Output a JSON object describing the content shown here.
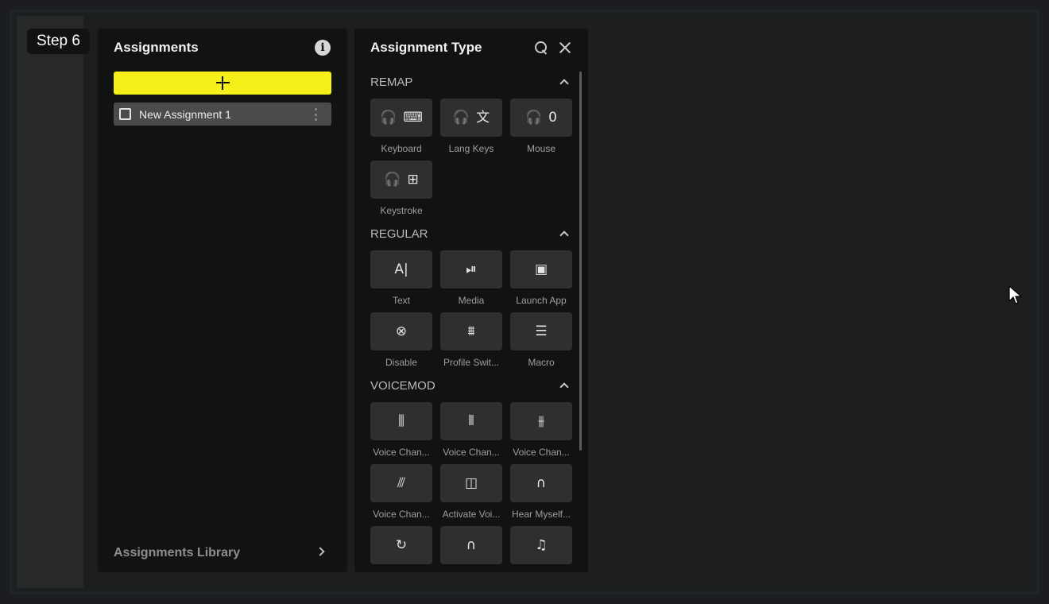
{
  "step_badge": "Step 6",
  "assignments": {
    "title": "Assignments",
    "items": [
      {
        "label": "New Assignment 1"
      }
    ],
    "library_label": "Assignments Library"
  },
  "assignment_type": {
    "title": "Assignment Type",
    "sections": [
      {
        "title": "REMAP",
        "tiles": [
          {
            "label": "Keyboard",
            "icons": [
              "headset",
              "keyboard"
            ]
          },
          {
            "label": "Lang Keys",
            "icons": [
              "headset",
              "translate"
            ]
          },
          {
            "label": "Mouse",
            "icons": [
              "headset",
              "mouse"
            ]
          },
          {
            "label": "Keystroke",
            "icons": [
              "headset",
              "keystroke"
            ]
          }
        ]
      },
      {
        "title": "REGULAR",
        "tiles": [
          {
            "label": "Text",
            "icons": [
              "text-cursor"
            ]
          },
          {
            "label": "Media",
            "icons": [
              "play-pause"
            ]
          },
          {
            "label": "Launch App",
            "icons": [
              "app-window"
            ]
          },
          {
            "label": "Disable",
            "icons": [
              "circle-x"
            ]
          },
          {
            "label": "Profile Swit...",
            "icons": [
              "profile-stack"
            ]
          },
          {
            "label": "Macro",
            "icons": [
              "list"
            ]
          }
        ]
      },
      {
        "title": "VOICEMOD",
        "tiles": [
          {
            "label": "Voice Chan...",
            "icons": [
              "voice-add"
            ]
          },
          {
            "label": "Voice Chan...",
            "icons": [
              "voice-bars"
            ]
          },
          {
            "label": "Voice Chan...",
            "icons": [
              "voice-down"
            ]
          },
          {
            "label": "Voice Chan...",
            "icons": [
              "voice-off"
            ]
          },
          {
            "label": "Activate Voi...",
            "icons": [
              "voice-activate"
            ]
          },
          {
            "label": "Hear Myself...",
            "icons": [
              "headphones"
            ]
          },
          {
            "label": "",
            "icons": [
              "headphones-refresh"
            ]
          },
          {
            "label": "",
            "icons": [
              "headphones-x"
            ]
          },
          {
            "label": "",
            "icons": [
              "music-note"
            ]
          }
        ]
      }
    ]
  },
  "colors": {
    "accent": "#f5f019",
    "panel": "#111312",
    "tile": "#2e302f"
  }
}
